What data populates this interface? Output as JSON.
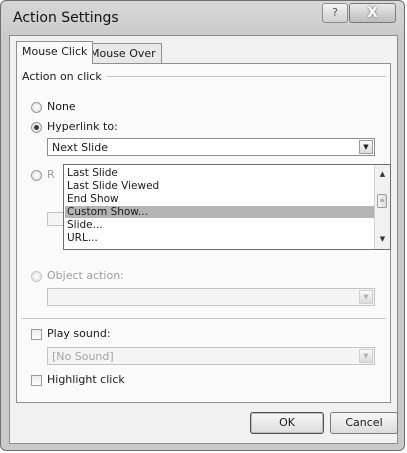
{
  "window": {
    "title": "Action Settings",
    "help_glyph": "?",
    "close_glyph": "X"
  },
  "tabs": [
    {
      "label": "Mouse Click",
      "selected": true
    },
    {
      "label": "Mouse Over",
      "selected": false
    }
  ],
  "action_group": {
    "caption": "Action on click",
    "none_label": "None",
    "hyperlink_label": "Hyperlink to:",
    "hyperlink_selected": true,
    "hyperlink_value": "Next Slide",
    "run_program_label": "R",
    "object_action_label": "Object action:"
  },
  "hyperlink_dropdown": {
    "items": [
      "Last Slide",
      "Last Slide Viewed",
      "End Show",
      "Custom Show...",
      "Slide...",
      "URL..."
    ],
    "selected_index": 3
  },
  "sound": {
    "play_sound_label": "Play sound:",
    "play_sound_checked": false,
    "sound_value": "[No Sound]",
    "highlight_label": "Highlight click",
    "highlight_checked": false
  },
  "buttons": {
    "ok_label": "OK",
    "cancel_label": "Cancel"
  }
}
